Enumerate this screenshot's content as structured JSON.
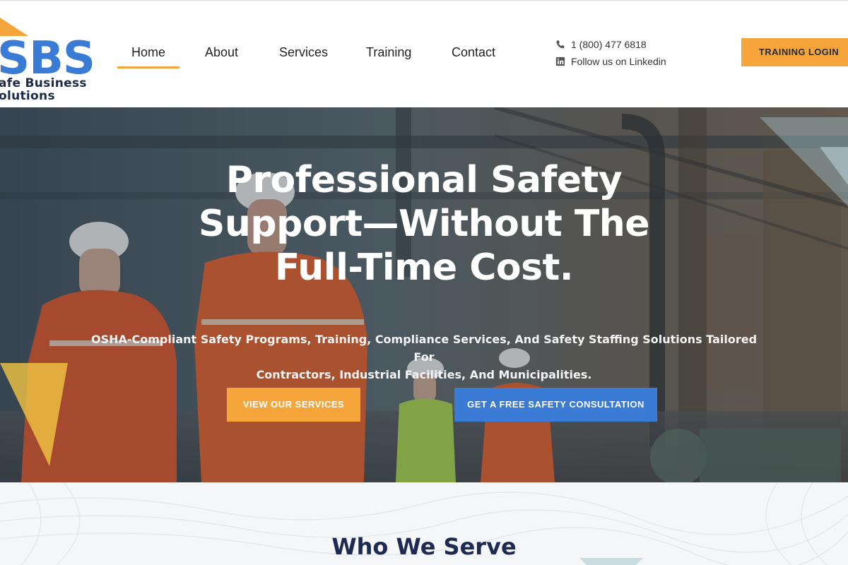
{
  "brand": {
    "mark": "SBS",
    "line1": "afe Business",
    "line2": "olutions",
    "colors": {
      "primary_blue": "#3a7bd5",
      "accent_orange": "#f5a53a",
      "navy": "#1e2a52"
    }
  },
  "nav": {
    "items": [
      {
        "label": "Home",
        "active": true
      },
      {
        "label": "About"
      },
      {
        "label": "Services"
      },
      {
        "label": "Training"
      },
      {
        "label": "Contact"
      }
    ]
  },
  "contact": {
    "phone": "1 (800) 477 6818",
    "phone_icon": "phone-icon",
    "linkedin": "Follow us on Linkedin",
    "linkedin_icon": "linkedin-icon"
  },
  "header": {
    "login_label": "TRAINING LOGIN"
  },
  "hero": {
    "title_line1": "Professional Safety",
    "title_line2": "Support—Without The",
    "title_line3": "Full-Time Cost.",
    "subtitle_line1": "OSHA-Compliant Safety Programs, Training, Compliance Services, And Safety Staffing Solutions Tailored For",
    "subtitle_line2": "Contractors, Industrial Facilities, And Municipalities.",
    "primary_cta": "VIEW OUR SERVICES",
    "secondary_cta": "GET A FREE SAFETY CONSULTATION"
  },
  "serve": {
    "title": "Who We Serve"
  }
}
